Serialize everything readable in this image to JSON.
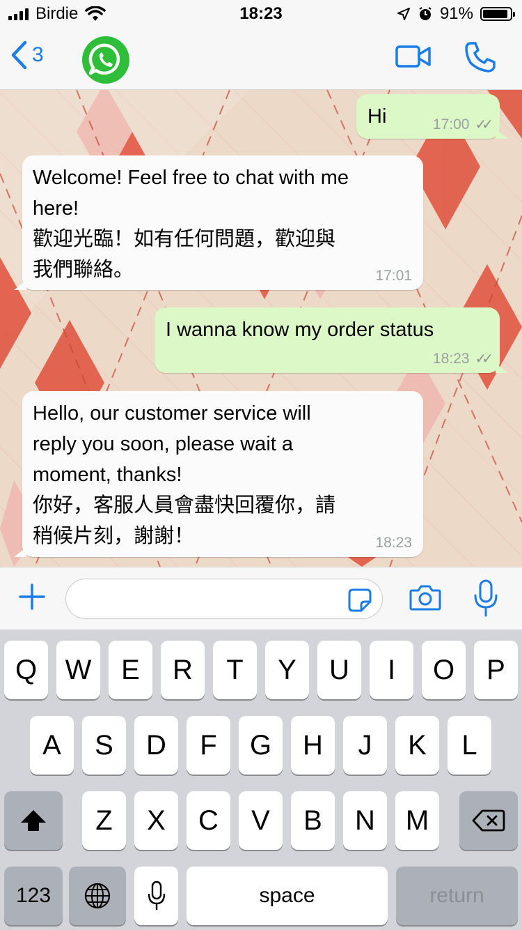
{
  "status_bar": {
    "carrier": "Birdie",
    "time": "18:23",
    "battery_percent": "91%",
    "battery_level": 0.91
  },
  "nav": {
    "back_count": "3",
    "accent_color": "#1b7de6",
    "logo_icon": "whatsapp-logo",
    "video_icon": "video-camera-icon",
    "call_icon": "phone-icon"
  },
  "messages": [
    {
      "direction": "outgoing",
      "text": "Hi",
      "time": "17:00",
      "read_ticks": "✓✓"
    },
    {
      "direction": "incoming",
      "text": "Welcome! Feel free to chat with me\nhere!\n歡迎光臨！如有任何問題，歡迎與\n我們聯絡。",
      "time": "17:01"
    },
    {
      "direction": "outgoing",
      "text": "I wanna know my order status",
      "time": "18:23",
      "read_ticks": "✓✓"
    },
    {
      "direction": "incoming",
      "text": "Hello, our customer service will\nreply you soon, please wait a\nmoment, thanks!\n你好，客服人員會盡快回覆你，請\n稍候片刻，謝謝！",
      "time": "18:23"
    }
  ],
  "composer": {
    "input_value": "",
    "input_placeholder": ""
  },
  "keyboard": {
    "row1": [
      "Q",
      "W",
      "E",
      "R",
      "T",
      "Y",
      "U",
      "I",
      "O",
      "P"
    ],
    "row2": [
      "A",
      "S",
      "D",
      "F",
      "G",
      "H",
      "J",
      "K",
      "L"
    ],
    "row3": [
      "Z",
      "X",
      "C",
      "V",
      "B",
      "N",
      "M"
    ],
    "numbers_key": "123",
    "space_key": "space",
    "return_key": "return"
  }
}
